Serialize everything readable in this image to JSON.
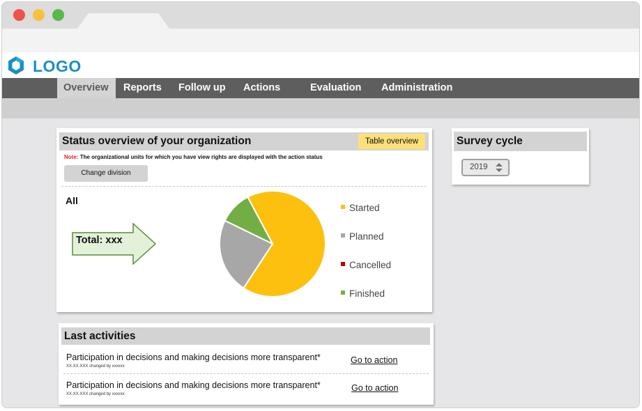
{
  "logo": {
    "text": "LOGO",
    "icon": "hexagon-logo-icon"
  },
  "nav": {
    "items": [
      {
        "label": "Overview",
        "active": true
      },
      {
        "label": "Reports"
      },
      {
        "label": "Follow up"
      },
      {
        "label": "Actions"
      },
      {
        "label": "Evaluation"
      },
      {
        "label": "Administration"
      }
    ]
  },
  "status": {
    "title": "Status overview of your organization",
    "table_button": "Table overview",
    "note_label": "Note:",
    "note_text": "The organizational units for which you have view rights are displayed with the action status",
    "change_button": "Change division",
    "group_label": "All",
    "total": "Total: xxx"
  },
  "chart_data": {
    "type": "pie",
    "categories": [
      "Started",
      "Planned",
      "Cancelled",
      "Finished"
    ],
    "values": [
      67,
      23,
      0,
      10
    ],
    "colors": [
      "#fdc00f",
      "#a7a7a7",
      "#c00000",
      "#72ad46"
    ],
    "legend_position": "right"
  },
  "survey": {
    "title": "Survey cycle",
    "selected_year": "2019"
  },
  "activities": {
    "title": "Last activities",
    "items": [
      {
        "title": "Participation in decisions and making decisions more transparent*",
        "meta": "XX.XX.XXX changed by xxxxxx",
        "link": "Go to action"
      },
      {
        "title": "Participation in decisions and making decisions more transparent*",
        "meta": "XX.XX.XXX changed by xxxxxx",
        "link": "Go to action"
      }
    ]
  },
  "colors": {
    "accent_blue": "#1a8fc4",
    "nav_bg": "#5e5e5e",
    "highlight_yellow": "#fde07a",
    "note_red": "#e51f1f"
  }
}
